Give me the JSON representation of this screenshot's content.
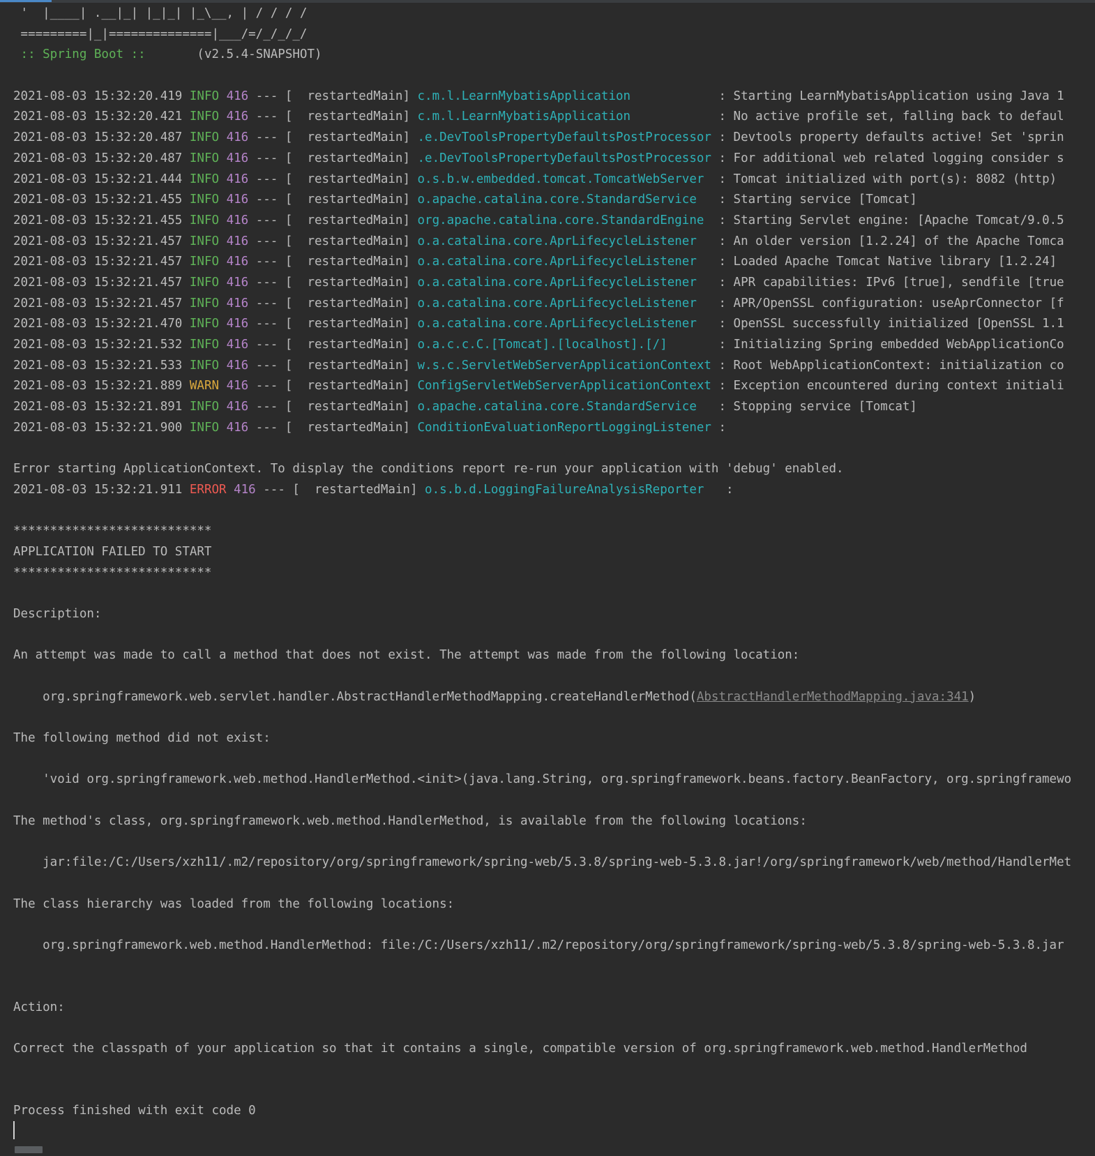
{
  "banner": {
    "line1": " '  |____| .__|_| |_|_| |_\\__, | / / / /",
    "line2": " =========|_|==============|___/=/_/_/_/",
    "label": " :: Spring Boot ::",
    "version": "       (v2.5.4-SNAPSHOT)"
  },
  "log_rows": [
    {
      "ts": "2021-08-03 15:32:20.419 ",
      "level": "INFO",
      "pid": "416",
      "sep": " --- [  restartedMain] ",
      "logger": "c.m.l.LearnMybatisApplication           ",
      "msg": " : Starting LearnMybatisApplication using Java 1"
    },
    {
      "ts": "2021-08-03 15:32:20.421 ",
      "level": "INFO",
      "pid": "416",
      "sep": " --- [  restartedMain] ",
      "logger": "c.m.l.LearnMybatisApplication           ",
      "msg": " : No active profile set, falling back to defaul"
    },
    {
      "ts": "2021-08-03 15:32:20.487 ",
      "level": "INFO",
      "pid": "416",
      "sep": " --- [  restartedMain] ",
      "logger": ".e.DevToolsPropertyDefaultsPostProcessor",
      "msg": " : Devtools property defaults active! Set 'sprin"
    },
    {
      "ts": "2021-08-03 15:32:20.487 ",
      "level": "INFO",
      "pid": "416",
      "sep": " --- [  restartedMain] ",
      "logger": ".e.DevToolsPropertyDefaultsPostProcessor",
      "msg": " : For additional web related logging consider s"
    },
    {
      "ts": "2021-08-03 15:32:21.444 ",
      "level": "INFO",
      "pid": "416",
      "sep": " --- [  restartedMain] ",
      "logger": "o.s.b.w.embedded.tomcat.TomcatWebServer ",
      "msg": " : Tomcat initialized with port(s): 8082 (http)"
    },
    {
      "ts": "2021-08-03 15:32:21.455 ",
      "level": "INFO",
      "pid": "416",
      "sep": " --- [  restartedMain] ",
      "logger": "o.apache.catalina.core.StandardService  ",
      "msg": " : Starting service [Tomcat]"
    },
    {
      "ts": "2021-08-03 15:32:21.455 ",
      "level": "INFO",
      "pid": "416",
      "sep": " --- [  restartedMain] ",
      "logger": "org.apache.catalina.core.StandardEngine ",
      "msg": " : Starting Servlet engine: [Apache Tomcat/9.0.5"
    },
    {
      "ts": "2021-08-03 15:32:21.457 ",
      "level": "INFO",
      "pid": "416",
      "sep": " --- [  restartedMain] ",
      "logger": "o.a.catalina.core.AprLifecycleListener  ",
      "msg": " : An older version [1.2.24] of the Apache Tomca"
    },
    {
      "ts": "2021-08-03 15:32:21.457 ",
      "level": "INFO",
      "pid": "416",
      "sep": " --- [  restartedMain] ",
      "logger": "o.a.catalina.core.AprLifecycleListener  ",
      "msg": " : Loaded Apache Tomcat Native library [1.2.24]"
    },
    {
      "ts": "2021-08-03 15:32:21.457 ",
      "level": "INFO",
      "pid": "416",
      "sep": " --- [  restartedMain] ",
      "logger": "o.a.catalina.core.AprLifecycleListener  ",
      "msg": " : APR capabilities: IPv6 [true], sendfile [true"
    },
    {
      "ts": "2021-08-03 15:32:21.457 ",
      "level": "INFO",
      "pid": "416",
      "sep": " --- [  restartedMain] ",
      "logger": "o.a.catalina.core.AprLifecycleListener  ",
      "msg": " : APR/OpenSSL configuration: useAprConnector [f"
    },
    {
      "ts": "2021-08-03 15:32:21.470 ",
      "level": "INFO",
      "pid": "416",
      "sep": " --- [  restartedMain] ",
      "logger": "o.a.catalina.core.AprLifecycleListener  ",
      "msg": " : OpenSSL successfully initialized [OpenSSL 1.1"
    },
    {
      "ts": "2021-08-03 15:32:21.532 ",
      "level": "INFO",
      "pid": "416",
      "sep": " --- [  restartedMain] ",
      "logger": "o.a.c.c.C.[Tomcat].[localhost].[/]      ",
      "msg": " : Initializing Spring embedded WebApplicationCo"
    },
    {
      "ts": "2021-08-03 15:32:21.533 ",
      "level": "INFO",
      "pid": "416",
      "sep": " --- [  restartedMain] ",
      "logger": "w.s.c.ServletWebServerApplicationContext",
      "msg": " : Root WebApplicationContext: initialization co"
    },
    {
      "ts": "2021-08-03 15:32:21.889 ",
      "level": "WARN",
      "pid": "416",
      "sep": " --- [  restartedMain] ",
      "logger": "ConfigServletWebServerApplicationContext",
      "msg": " : Exception encountered during context initiali"
    },
    {
      "ts": "2021-08-03 15:32:21.891 ",
      "level": "INFO",
      "pid": "416",
      "sep": " --- [  restartedMain] ",
      "logger": "o.apache.catalina.core.StandardService  ",
      "msg": " : Stopping service [Tomcat]"
    },
    {
      "ts": "2021-08-03 15:32:21.900 ",
      "level": "INFO",
      "pid": "416",
      "sep": " --- [  restartedMain] ",
      "logger": "ConditionEvaluationReportLoggingListener",
      "msg": " :"
    }
  ],
  "error_context_line": "Error starting ApplicationContext. To display the conditions report re-run your application with 'debug' enabled.",
  "error_row": {
    "ts": "2021-08-03 15:32:21.911 ",
    "level": "ERROR",
    "pid": "416",
    "sep": " --- [  restartedMain] ",
    "logger": "o.s.b.d.LoggingFailureAnalysisReporter  ",
    "msg": " :"
  },
  "failure": {
    "stars": "***************************",
    "title": "APPLICATION FAILED TO START",
    "description_label": "Description:",
    "description_text": "An attempt was made to call a method that does not exist. The attempt was made from the following location:",
    "location_prefix": "    org.springframework.web.servlet.handler.AbstractHandlerMethodMapping.createHandlerMethod(",
    "location_link": "AbstractHandlerMethodMapping.java:341",
    "location_suffix": ")",
    "method_label": "The following method did not exist:",
    "method_text": "    'void org.springframework.web.method.HandlerMethod.<init>(java.lang.String, org.springframework.beans.factory.BeanFactory, org.springframewo",
    "class_label": "The method's class, org.springframework.web.method.HandlerMethod, is available from the following locations:",
    "class_location": "    jar:file:/C:/Users/xzh11/.m2/repository/org/springframework/spring-web/5.3.8/spring-web-5.3.8.jar!/org/springframework/web/method/HandlerMet",
    "hierarchy_label": "The class hierarchy was loaded from the following locations:",
    "hierarchy_text": "    org.springframework.web.method.HandlerMethod: file:/C:/Users/xzh11/.m2/repository/org/springframework/spring-web/5.3.8/spring-web-5.3.8.jar",
    "action_label": "Action:",
    "action_text": "Correct the classpath of your application so that it contains a single, compatible version of org.springframework.web.method.HandlerMethod"
  },
  "process_exit": "Process finished with exit code 0",
  "colors": {
    "background": "#2b2b2b",
    "text": "#bbbbbb",
    "info": "#5fb257",
    "warn": "#d9a83d",
    "error": "#ee5a52",
    "pid": "#b584c9",
    "logger": "#2eb1b7"
  }
}
